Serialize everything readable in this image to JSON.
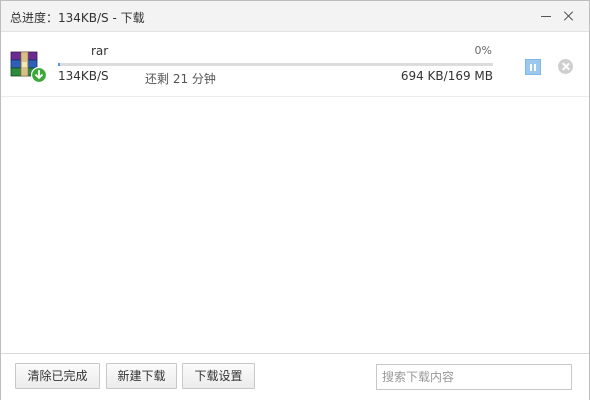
{
  "window": {
    "title": "总进度：134KB/S - 下载",
    "minimize_icon": "minimize-icon",
    "close_icon": "close-icon"
  },
  "downloads": [
    {
      "icon": "winrar-archive-icon",
      "name": "rar",
      "percent": "0%",
      "progress": 0.004,
      "speed": "134KB/S",
      "remaining": "还剩 21 分钟",
      "size": "694 KB/169 MB",
      "pause_icon": "pause-icon",
      "cancel_icon": "cancel-circle-icon"
    }
  ],
  "footer": {
    "clear_label": "清除已完成",
    "new_label": "新建下载",
    "settings_label": "下载设置",
    "search_placeholder": "搜索下载内容"
  },
  "colors": {
    "progress": "#4a9ee6",
    "pause_button": "#9cc8f0",
    "title_bar": "#f3f3f3"
  }
}
